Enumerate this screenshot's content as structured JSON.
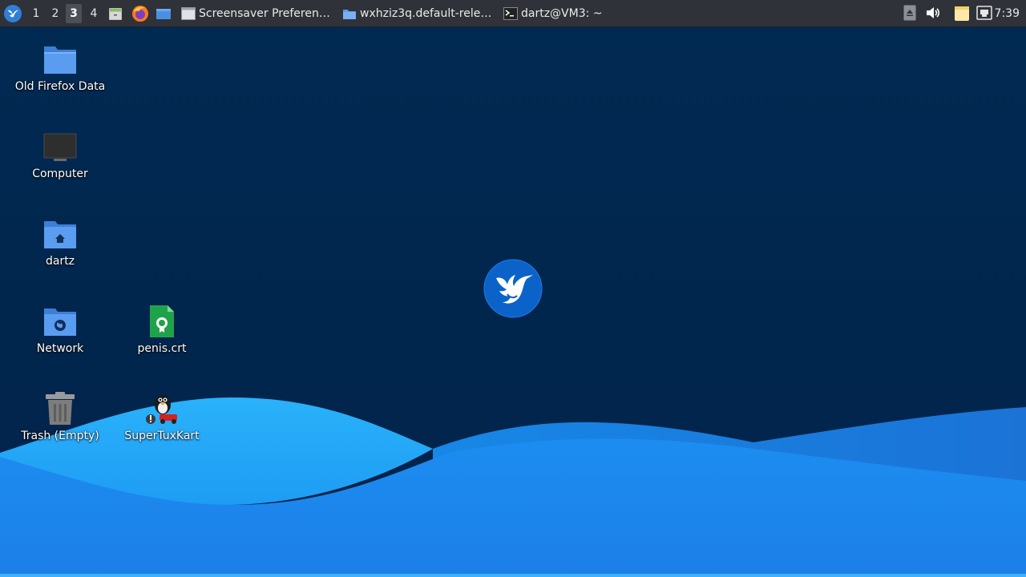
{
  "panel": {
    "workspaces": [
      {
        "label": "1",
        "active": false
      },
      {
        "label": "2",
        "active": false
      },
      {
        "label": "3",
        "active": true
      },
      {
        "label": "4",
        "active": false
      }
    ],
    "tasks": [
      {
        "title": "Screensaver Preferen…",
        "icon": "window-icon"
      },
      {
        "title": "wxhziz3q.default-rele…",
        "icon": "folder-icon"
      },
      {
        "title": "dartz@VM3: ~",
        "icon": "terminal-icon"
      }
    ],
    "clock": "7:39"
  },
  "desktop": {
    "icons": [
      {
        "label": "Old Firefox Data",
        "icon": "folder-icon"
      },
      {
        "label": "Computer",
        "icon": "computer-icon"
      },
      {
        "label": "dartz",
        "icon": "home-folder-icon"
      },
      {
        "label": "Network",
        "icon": "network-folder-icon"
      },
      {
        "label": "penis.crt",
        "icon": "certificate-file-icon"
      },
      {
        "label": "Trash (Empty)",
        "icon": "trash-icon"
      },
      {
        "label": "SuperTuxKart",
        "icon": "supertuxkart-icon"
      }
    ]
  },
  "colors": {
    "wallpaper_dark": "#01264d",
    "wave_light": "#29a8f5",
    "wave_mid": "#1a8cef",
    "panel_bg": "#2f3238"
  }
}
